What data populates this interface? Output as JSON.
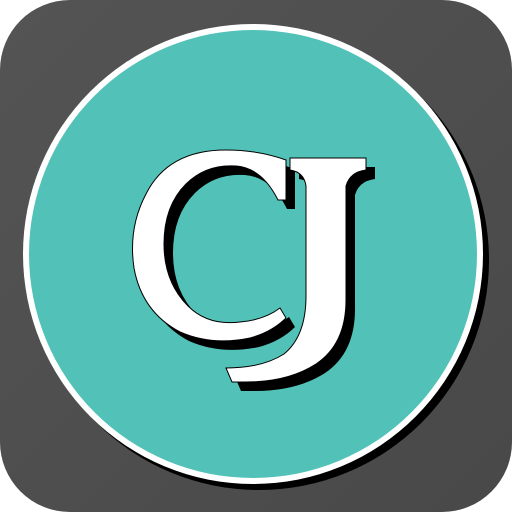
{
  "icon": {
    "monogram": "CJ",
    "letters": [
      "C",
      "J"
    ],
    "colors": {
      "tile": "#4d4d4d",
      "ring": "#ffffff",
      "fill": "#52c2b8",
      "letter": "#ffffff",
      "letter_shadow": "#000000"
    }
  }
}
